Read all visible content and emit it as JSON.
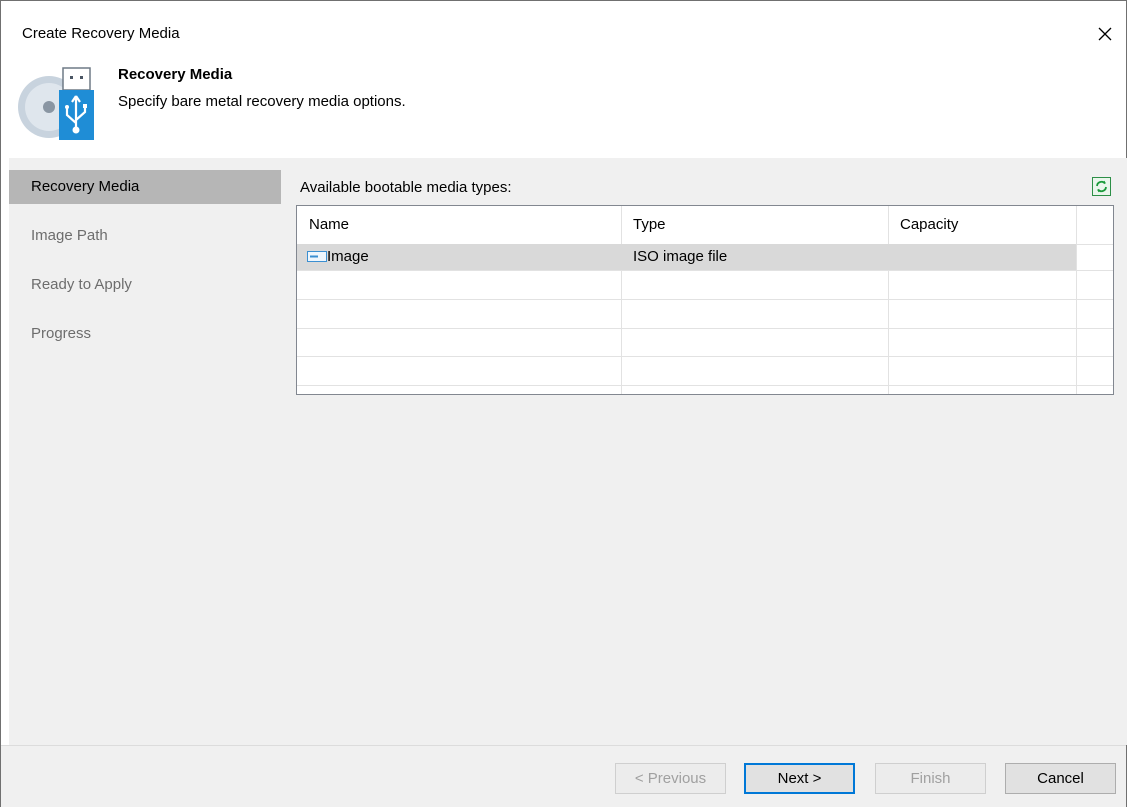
{
  "window": {
    "title": "Create Recovery Media"
  },
  "header": {
    "title": "Recovery Media",
    "subtitle": "Specify bare metal recovery media options."
  },
  "sidebar": {
    "items": [
      {
        "label": "Recovery Media",
        "active": true
      },
      {
        "label": "Image Path",
        "active": false
      },
      {
        "label": "Ready to Apply",
        "active": false
      },
      {
        "label": "Progress",
        "active": false
      }
    ]
  },
  "main": {
    "caption": "Available bootable media types:",
    "columns": [
      "Name",
      "Type",
      "Capacity"
    ],
    "rows": [
      {
        "name": "Image",
        "type": "ISO image file",
        "capacity": "",
        "selected": true
      }
    ]
  },
  "footer": {
    "previous": "< Previous",
    "next": "Next >",
    "finish": "Finish",
    "cancel": "Cancel"
  },
  "colors": {
    "accent": "#0078d7",
    "selection": "#b6b6b6",
    "refresh_icon": "#1a9a3a"
  }
}
